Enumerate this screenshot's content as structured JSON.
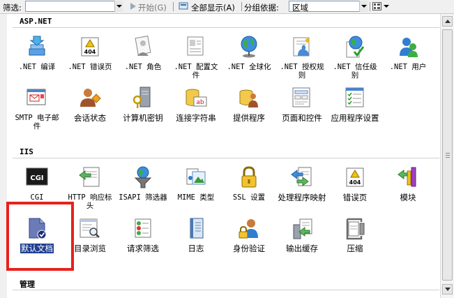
{
  "toolbar": {
    "filter_label": "筛选:",
    "start_label": "开始(G)",
    "show_all_label": "全部显示(A)",
    "group_by_label": "分组依据:",
    "group_by_value": "区域"
  },
  "sections": {
    "aspnet": "ASP.NET",
    "iis": "IIS",
    "manage": "管理"
  },
  "aspnet_items": [
    ".NET 编译",
    ".NET 错误页",
    ".NET 角色",
    ".NET 配置文件",
    ".NET 全球化",
    ".NET 授权规则",
    ".NET 信任级别",
    ".NET 用户",
    "SMTP 电子邮件",
    "会话状态",
    "计算机密钥",
    "连接字符串",
    "提供程序",
    "页面和控件",
    "应用程序设置"
  ],
  "iis_items": [
    "CGI",
    "HTTP 响应标头",
    "ISAPI 筛选器",
    "MIME 类型",
    "SSL 设置",
    "处理程序映射",
    "错误页",
    "模块",
    "默认文档",
    "目录浏览",
    "请求筛选",
    "日志",
    "身份验证",
    "输出缓存",
    "压缩"
  ],
  "icons": {
    "cgi_text": "CGI",
    "err404_text": "404",
    "ab_text": "ab"
  },
  "colors": {
    "highlight": "#e8211b",
    "selection": "#1f3f8f"
  }
}
